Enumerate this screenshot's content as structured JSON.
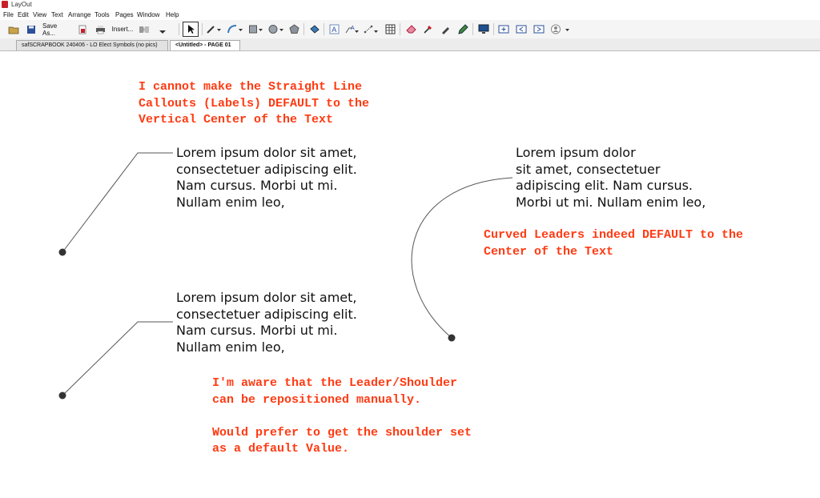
{
  "window": {
    "title": "LayOut"
  },
  "menu": [
    "File",
    "Edit",
    "View",
    "Text",
    "Arrange",
    "Tools",
    "Pages",
    "Window",
    "Help"
  ],
  "toolbar": {
    "save_as": "Save As...",
    "insert": "Insert..."
  },
  "tabs": [
    "safSCRAPBOOK 240406 - LO Elect Symbols (no pics)",
    "<Untitled> - PAGE 01"
  ],
  "canvas": {
    "note_top": "I cannot make the Straight Line\nCallouts (Labels) DEFAULT to the\nVertical Center of the Text",
    "label_1": "Lorem ipsum dolor sit amet,\nconsectetuer adipiscing elit.\nNam cursus. Morbi ut mi.\nNullam enim leo,",
    "label_2": "Lorem ipsum dolor\nsit amet, consectetuer\nadipiscing elit. Nam cursus.\nMorbi ut mi. Nullam enim leo,",
    "note_curved": "Curved Leaders indeed DEFAULT to the\nCenter of the Text",
    "label_3": "Lorem ipsum dolor sit amet,\nconsectetuer adipiscing elit.\nNam cursus. Morbi ut mi.\nNullam enim leo,",
    "note_bottom": "I'm aware that the Leader/Shoulder\ncan be repositioned manually.\n\nWould prefer to get the shoulder set\nas a default Value."
  },
  "colors": {
    "note": "#ff3a12",
    "leader": "#555555",
    "anchor": "#333333"
  }
}
